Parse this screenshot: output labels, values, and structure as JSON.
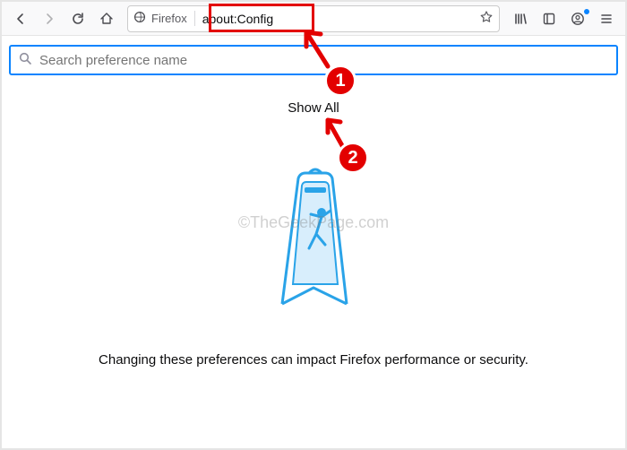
{
  "toolbar": {
    "identity_label": "Firefox",
    "url": "about:Config"
  },
  "search": {
    "placeholder": "Search preference name"
  },
  "main": {
    "show_all": "Show All",
    "caption": "Changing these preferences can impact Firefox performance or security."
  },
  "watermark": "©TheGeekPage.com",
  "annotations": {
    "b1": "1",
    "b2": "2"
  }
}
